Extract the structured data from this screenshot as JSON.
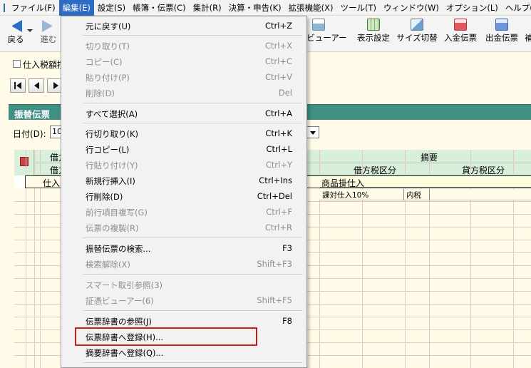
{
  "menubar": {
    "items": [
      "ファイル(F)",
      "編集(E)",
      "設定(S)",
      "帳簿・伝票(C)",
      "集計(R)",
      "決算・申告(K)",
      "拡張機能(X)",
      "ツール(T)",
      "ウィンドウ(W)",
      "オプション(L)",
      "ヘルプ(H)"
    ],
    "active": "編集(E)"
  },
  "toolbar": {
    "back": "戻る",
    "forward": "進む",
    "viewer_partial": "証憑ビューアー",
    "display_settings": "表示設定",
    "size_toggle": "サイズ切替",
    "receipt_voucher": "入金伝票",
    "payment_voucher": "出金伝票",
    "cut_off": "補"
  },
  "options": {
    "checkbox_label": "仕入税額控"
  },
  "section": {
    "title": "振替伝票"
  },
  "date": {
    "label": "日付(D):",
    "value": "10"
  },
  "grid": {
    "header_debit_partial": "借方",
    "header_debit_sub_partial": "借方",
    "header_summary": "摘要",
    "header_debit_tax": "借方税区分",
    "header_credit_tax": "貸方税区分",
    "row1_debit_account": "仕入",
    "row1_summary": "商品掛仕入",
    "row1_tax_category": "課対仕入10%",
    "row1_tax_type": "内税"
  },
  "edit_menu": {
    "items": [
      {
        "label": "元に戻す(U)",
        "shortcut": "Ctrl+Z",
        "enabled": true
      },
      {
        "label": "切り取り(T)",
        "shortcut": "Ctrl+X",
        "enabled": false
      },
      {
        "label": "コピー(C)",
        "shortcut": "Ctrl+C",
        "enabled": false
      },
      {
        "label": "貼り付け(P)",
        "shortcut": "Ctrl+V",
        "enabled": false
      },
      {
        "label": "削除(D)",
        "shortcut": "Del",
        "enabled": false
      },
      {
        "label": "すべて選択(A)",
        "shortcut": "Ctrl+A",
        "enabled": true
      },
      {
        "label": "行切り取り(K)",
        "shortcut": "Ctrl+K",
        "enabled": true
      },
      {
        "label": "行コピー(L)",
        "shortcut": "Ctrl+L",
        "enabled": true
      },
      {
        "label": "行貼り付け(Y)",
        "shortcut": "Ctrl+Y",
        "enabled": false
      },
      {
        "label": "新規行挿入(I)",
        "shortcut": "Ctrl+Ins",
        "enabled": true
      },
      {
        "label": "行削除(D)",
        "shortcut": "Ctrl+Del",
        "enabled": true
      },
      {
        "label": "前行項目複写(G)",
        "shortcut": "Ctrl+F",
        "enabled": false
      },
      {
        "label": "伝票の複製(R)",
        "shortcut": "Ctrl+R",
        "enabled": false
      },
      {
        "label": "振替伝票の検索...",
        "shortcut": "F3",
        "enabled": true
      },
      {
        "label": "検索解除(X)",
        "shortcut": "Shift+F3",
        "enabled": false
      },
      {
        "label": "スマート取引参照(3)",
        "shortcut": "",
        "enabled": false
      },
      {
        "label": "証憑ビューアー(6)",
        "shortcut": "Shift+F5",
        "enabled": false
      },
      {
        "label": "伝票辞書の参照(J)",
        "shortcut": "F8",
        "enabled": true
      },
      {
        "label": "伝票辞書へ登録(H)...",
        "shortcut": "",
        "enabled": true
      },
      {
        "label": "摘要辞書へ登録(Q)...",
        "shortcut": "",
        "enabled": true
      }
    ],
    "highlighted": "伝票辞書へ登録(H)..."
  },
  "colors": {
    "menu_active": "#2f6bc1",
    "section_bar": "#3f8f83",
    "grid_header": "#d9efdb",
    "grid_background": "#fffbe6",
    "highlight_border": "#d11a1a"
  }
}
